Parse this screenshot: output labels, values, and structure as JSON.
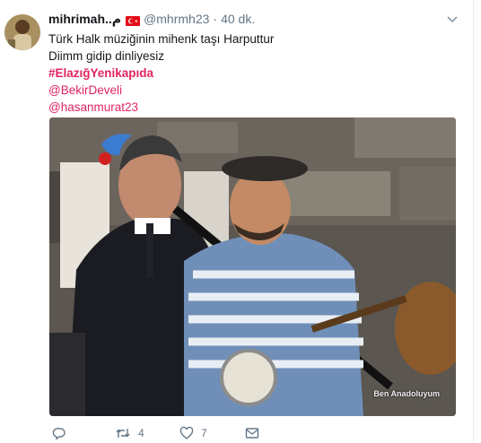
{
  "tweet": {
    "display_name": "mihrimah..م",
    "handle": "@mhrmh23",
    "separator": "·",
    "time": "40 dk.",
    "lines": [
      "Türk Halk müziğinin mihenk taşı Harputtur",
      "Diimm gidip dinliyesiz"
    ],
    "hashtag": "#ElazığYenikapıda",
    "mentions": [
      "@BekirDeveli",
      "@hasanmurat23"
    ],
    "media": {
      "watermark": "Ben Anadoluyum"
    }
  },
  "actions": {
    "reply_count": "",
    "retweet_count": "4",
    "like_count": "7"
  },
  "colors": {
    "accent": "#e0245e",
    "secondary_text": "#657786",
    "flag_red": "#e30a17"
  },
  "icons": [
    "turkish-flag-icon",
    "chevron-down-icon",
    "reply-icon",
    "retweet-icon",
    "like-icon",
    "direct-message-icon"
  ]
}
